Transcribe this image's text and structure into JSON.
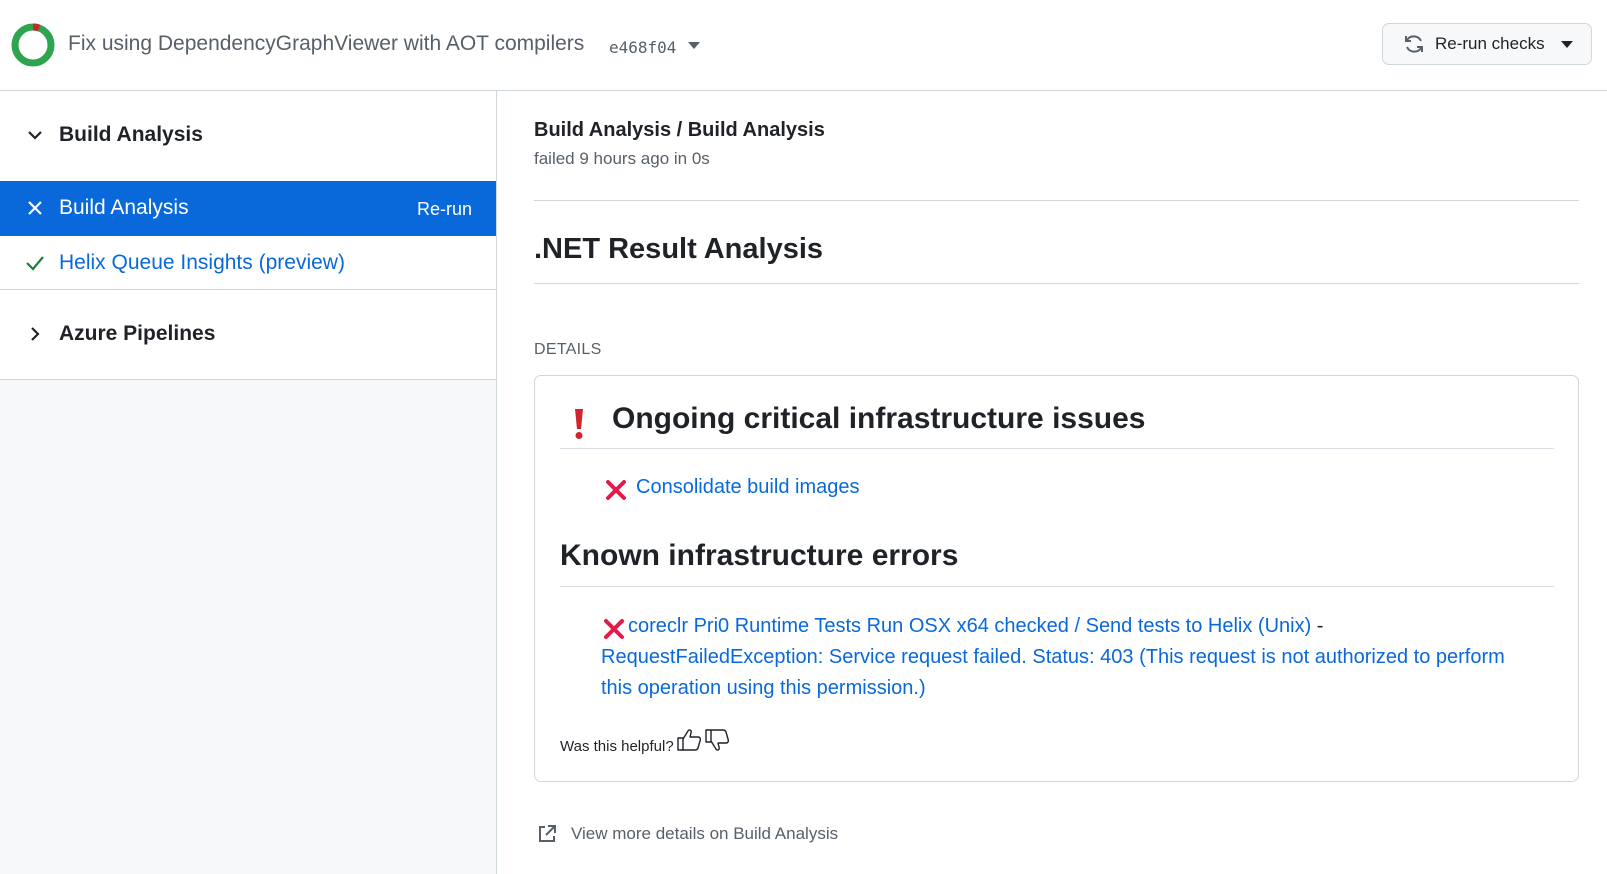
{
  "header": {
    "commit_title": "Fix using DependencyGraphViewer with AOT compilers",
    "commit_sha": "e468f04",
    "rerun_button_label": "Re-run checks",
    "status_colors": {
      "success": "#2da44e",
      "failure": "#cf222e"
    }
  },
  "sidebar": {
    "groups": [
      {
        "label": "Build Analysis",
        "expanded": true,
        "jobs": [
          {
            "label": "Build Analysis",
            "status": "failed",
            "selected": true,
            "action": "Re-run"
          },
          {
            "label": "Helix Queue Insights (preview)",
            "status": "success",
            "selected": false
          }
        ]
      },
      {
        "label": "Azure Pipelines",
        "expanded": false
      }
    ]
  },
  "main": {
    "breadcrumb": "Build Analysis / Build Analysis",
    "status_line": "failed 9 hours ago in 0s",
    "result_heading": ".NET Result Analysis",
    "details_label": "DETAILS",
    "card": {
      "ongoing_heading": "Ongoing critical infrastructure issues",
      "ongoing_items": [
        "Consolidate build images"
      ],
      "known_heading": "Known infrastructure errors",
      "known_error": {
        "link_text": "coreclr Pri0 Runtime Tests Run OSX x64 checked / Send tests to Helix (Unix)",
        "separator": " -",
        "message_line1": "RequestFailedException: Service request failed. Status: 403 (This request is not authorized to perform",
        "message_line2": "this operation using this permission.)"
      },
      "helpful_prompt": "Was this helpful?"
    },
    "view_more": "View more details on Build Analysis"
  },
  "colors": {
    "accent": "#0969da",
    "selected_bg": "#0969da",
    "error_x": "#e5194a",
    "critical": "#d1242f"
  }
}
